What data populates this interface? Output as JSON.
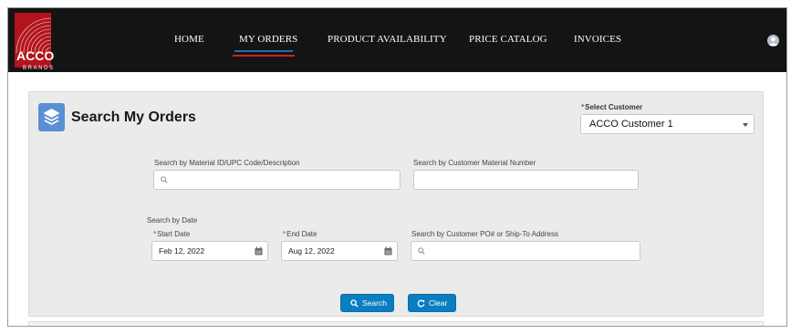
{
  "brand": {
    "name": "ACCO",
    "sub": "BRANDS",
    "accent": "#b3141b"
  },
  "nav": [
    {
      "label": "HOME"
    },
    {
      "label": "MY ORDERS",
      "active": true
    },
    {
      "label": "PRODUCT AVAILABILITY"
    },
    {
      "label": "PRICE CATALOG"
    },
    {
      "label": "INVOICES"
    }
  ],
  "user": {
    "icon": "user-avatar-icon"
  },
  "search": {
    "title": "Search My Orders",
    "title_icon": "stacked-layers-icon",
    "customer": {
      "label": "Select Customer",
      "required": "*",
      "value": "ACCO Customer 1"
    },
    "material": {
      "label": "Search by Material ID/UPC Code/Description",
      "value": ""
    },
    "customer_material": {
      "label": "Search by Customer Material Number",
      "value": ""
    },
    "date_section": "Search by Date",
    "start_date": {
      "label": "Start Date",
      "required": "*",
      "value": "Feb 12, 2022"
    },
    "end_date": {
      "label": "End Date",
      "required": "*",
      "value": "Aug 12, 2022"
    },
    "po": {
      "label": "Search by Customer PO# or Ship-To Address",
      "value": ""
    },
    "buttons": {
      "search": "Search",
      "clear": "Clear"
    }
  },
  "colors": {
    "nav_bg": "#141414",
    "panel_bg": "#ebebeb",
    "button": "#0b7ec1",
    "required": "#c23934"
  }
}
